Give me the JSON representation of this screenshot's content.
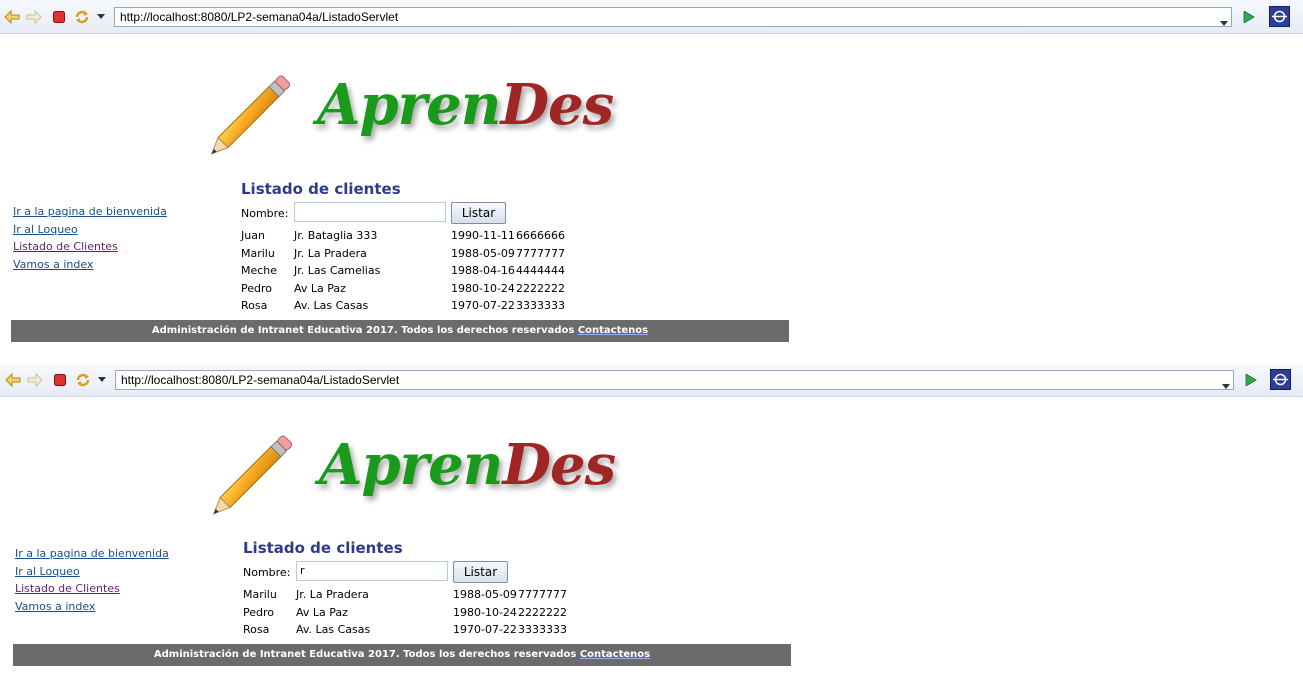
{
  "colors": {
    "logo_green": "#1a9a1a",
    "logo_red": "#a02525",
    "heading": "#2f3a8c",
    "footer_bg": "#6b6b6b",
    "link": "#1a4e8a",
    "visited_link": "#6a1b7a"
  },
  "shot1": {
    "browser": {
      "url": "http://localhost:8080/LP2-semana04a/ListadoServlet"
    },
    "logo": {
      "part1": "Apren",
      "part2": "Des"
    },
    "nav": [
      "Ir a la pagina de bienvenida",
      "Ir al Loqueo",
      "Listado de Clientes",
      "Vamos a index"
    ],
    "heading": "Listado de clientes",
    "form": {
      "label": "Nombre:",
      "value": "",
      "button": "Listar"
    },
    "rows": [
      [
        "Juan",
        "Jr. Bataglia 333",
        "1990-11-11",
        "6666666"
      ],
      [
        "Marilu",
        "Jr. La Pradera",
        "1988-05-09",
        "7777777"
      ],
      [
        "Meche",
        "Jr. Las Camelias",
        "1988-04-16",
        "4444444"
      ],
      [
        "Pedro",
        "Av La Paz",
        "1980-10-24",
        "2222222"
      ],
      [
        "Rosa",
        "Av. Las Casas",
        "1970-07-22",
        "3333333"
      ]
    ],
    "footer": {
      "text": "Administración de Intranet Educativa 2017. Todos los derechos reservados ",
      "link": "Contactenos"
    }
  },
  "shot2": {
    "browser": {
      "url": "http://localhost:8080/LP2-semana04a/ListadoServlet"
    },
    "logo": {
      "part1": "Apren",
      "part2": "Des"
    },
    "nav": [
      "Ir a la pagina de bienvenida",
      "Ir al Loqueo",
      "Listado de Clientes",
      "Vamos a index"
    ],
    "heading": "Listado de clientes",
    "form": {
      "label": "Nombre:",
      "value": "r",
      "button": "Listar"
    },
    "rows": [
      [
        "Marilu",
        "Jr. La Pradera",
        "1988-05-09",
        "7777777"
      ],
      [
        "Pedro",
        "Av La Paz",
        "1980-10-24",
        "2222222"
      ],
      [
        "Rosa",
        "Av. Las Casas",
        "1970-07-22",
        "3333333"
      ]
    ],
    "footer": {
      "text": "Administración de Intranet Educativa 2017. Todos los derechos reservados ",
      "link": "Contactenos"
    }
  }
}
